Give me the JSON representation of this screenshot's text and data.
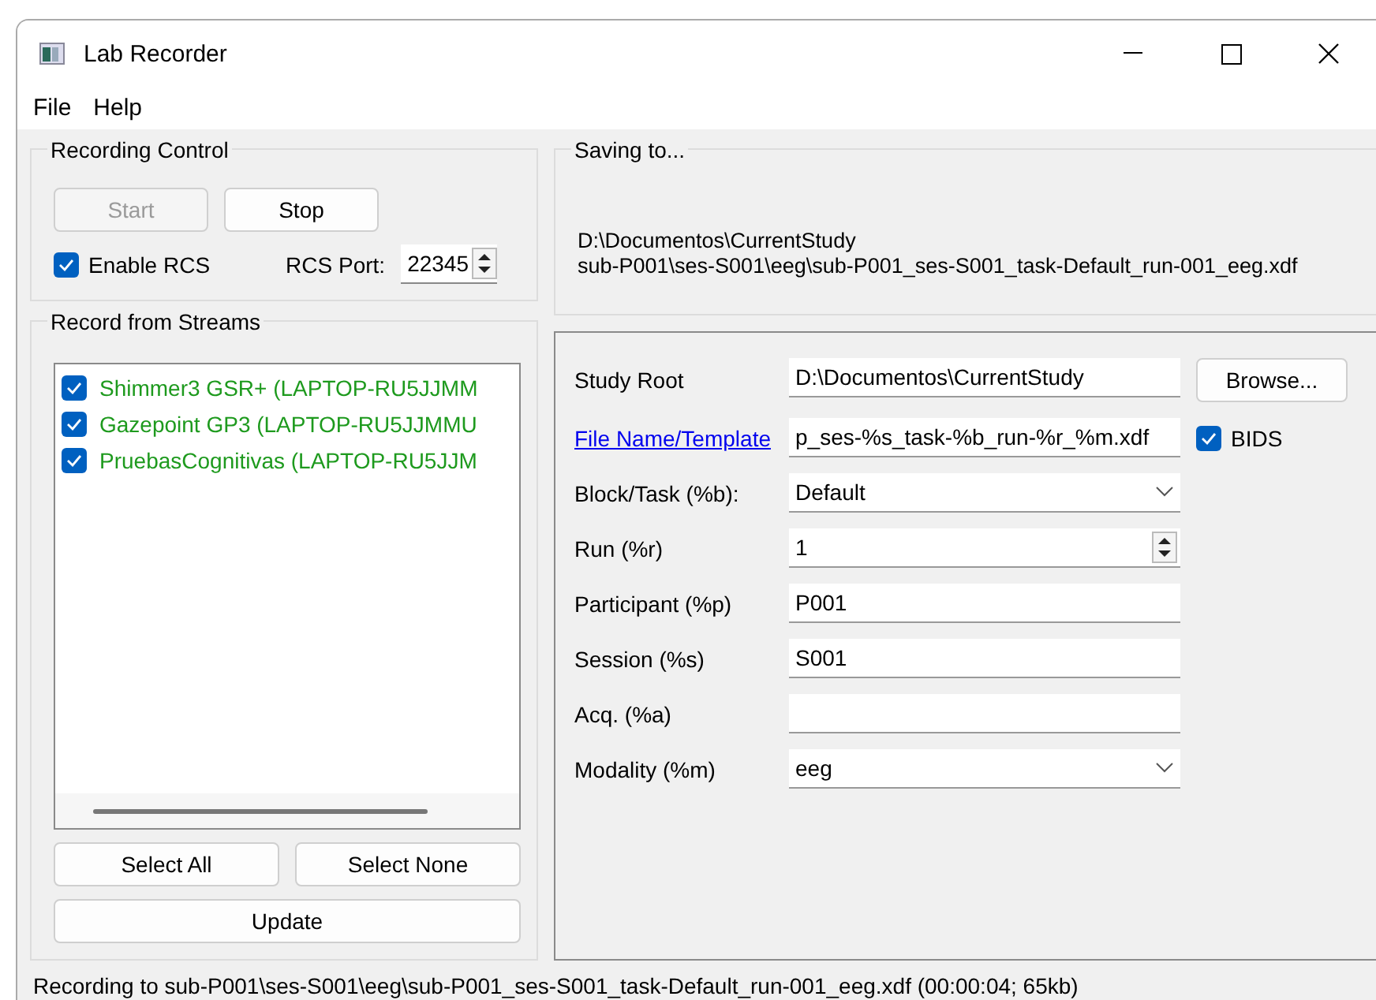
{
  "window": {
    "title": "Lab Recorder"
  },
  "menu": [
    {
      "label": "File"
    },
    {
      "label": "Help"
    }
  ],
  "recording_control": {
    "title": "Recording Control",
    "start": {
      "label": "Start",
      "disabled": true
    },
    "stop": {
      "label": "Stop",
      "disabled": false
    },
    "enable_rcs": {
      "label": "Enable RCS",
      "checked": true
    },
    "rcs_port": {
      "label": "RCS Port:",
      "value": "22345"
    }
  },
  "streams": {
    "title": "Record from Streams",
    "items": [
      {
        "label": "Shimmer3 GSR+ (LAPTOP-RU5JJMM",
        "checked": true
      },
      {
        "label": "Gazepoint GP3 (LAPTOP-RU5JJMMU",
        "checked": true
      },
      {
        "label": "PruebasCognitivas (LAPTOP-RU5JJM",
        "checked": true
      }
    ],
    "select_all": "Select All",
    "select_none": "Select None",
    "update": "Update"
  },
  "saving_to": {
    "title": "Saving to...",
    "lines": [
      "D:\\Documentos\\CurrentStudy",
      "sub-P001\\ses-S001\\eeg\\sub-P001_ses-S001_task-Default_run-001_eeg.xdf"
    ]
  },
  "form": [
    {
      "kind": "text",
      "label": "Study Root",
      "value": "D:\\Documentos\\CurrentStudy",
      "button": "Browse..."
    },
    {
      "kind": "text",
      "label": "File Name/Template",
      "label_link": true,
      "value": "p_ses-%s_task-%b_run-%r_%m.xdf",
      "checkbox": {
        "label": "BIDS",
        "checked": true
      }
    },
    {
      "kind": "combo",
      "label": "Block/Task (%b):",
      "value": "Default"
    },
    {
      "kind": "spin",
      "label": "Run (%r)",
      "value": "1"
    },
    {
      "kind": "text",
      "label": "Participant (%p)",
      "value": "P001"
    },
    {
      "kind": "text",
      "label": "Session (%s)",
      "value": "S001"
    },
    {
      "kind": "text",
      "label": "Acq. (%a)"
    },
    {
      "kind": "combo",
      "label": "Modality (%m)",
      "value": "eeg"
    }
  ],
  "status_bar": "Recording to sub-P001\\ses-S001\\eeg\\sub-P001_ses-S001_task-Default_run-001_eeg.xdf (00:00:04; 65kb)"
}
